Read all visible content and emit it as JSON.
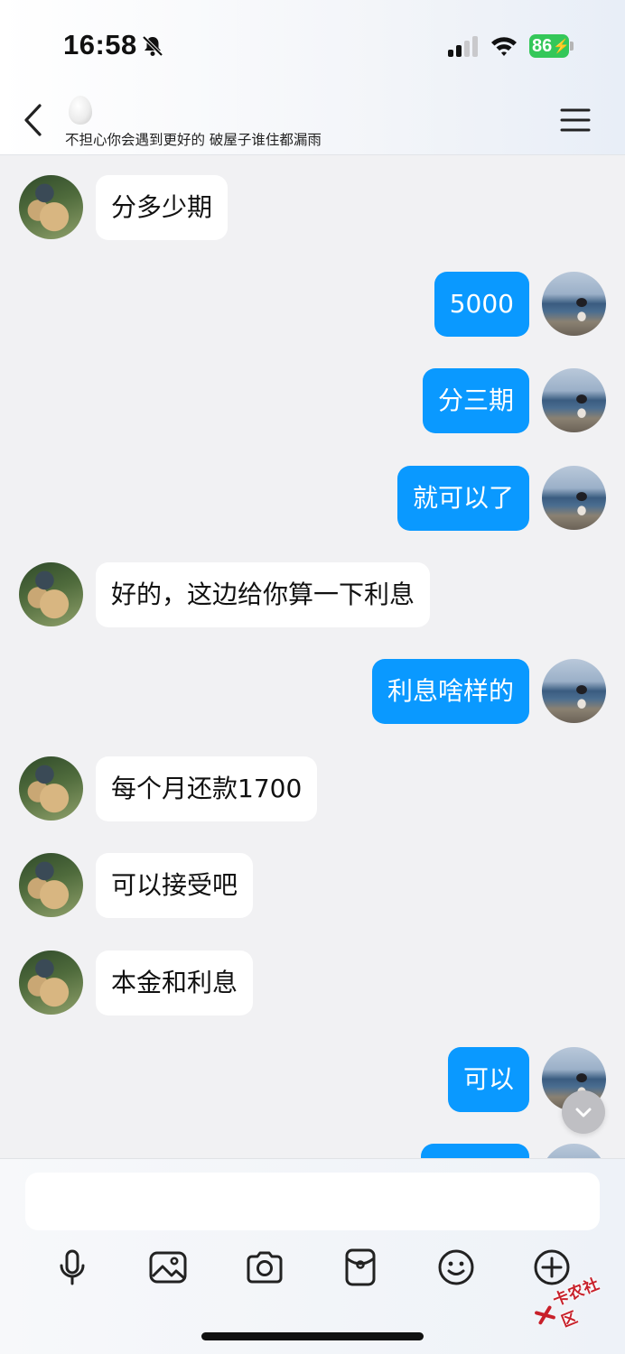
{
  "status_bar": {
    "time": "16:58",
    "battery": "86",
    "battery_color": "#34c759"
  },
  "header": {
    "contact_subtitle": "不担心你会遇到更好的 破屋子谁住都漏雨",
    "icons": [
      "back-icon",
      "egg-icon",
      "menu-icon"
    ]
  },
  "messages": [
    {
      "side": "in",
      "text": "分多少期"
    },
    {
      "side": "out",
      "text": "5000"
    },
    {
      "side": "out",
      "text": "分三期"
    },
    {
      "side": "out",
      "text": "就可以了"
    },
    {
      "side": "in",
      "text": "好的，这边给你算一下利息"
    },
    {
      "side": "out",
      "text": "利息啥样的"
    },
    {
      "side": "in",
      "text": "每个月还款1700"
    },
    {
      "side": "in",
      "text": "可以接受吧"
    },
    {
      "side": "in",
      "text": "本金和利息"
    },
    {
      "side": "out",
      "text": "可以"
    },
    {
      "side": "out",
      "text": ""
    }
  ],
  "colors": {
    "outgoing_bubble": "#0a99ff",
    "incoming_bubble": "#ffffff",
    "chat_background": "#f1f1f3"
  },
  "input": {
    "placeholder": "",
    "value": ""
  },
  "toolbar": {
    "icons": [
      "microphone-icon",
      "image-icon",
      "camera-icon",
      "red-packet-icon",
      "emoji-icon",
      "plus-icon"
    ]
  },
  "watermark": {
    "text": "卡农社区"
  }
}
